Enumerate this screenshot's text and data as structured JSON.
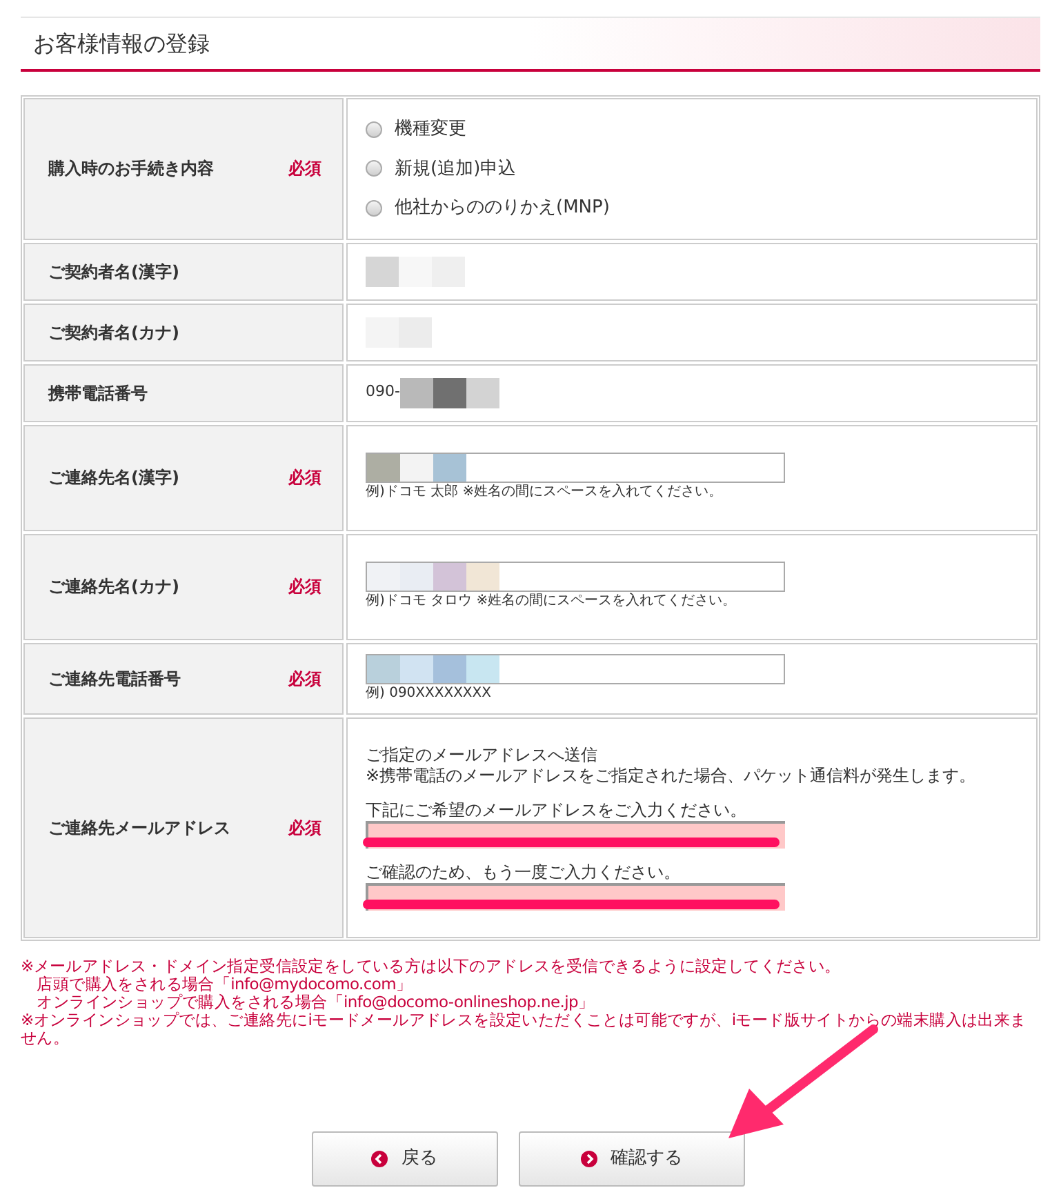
{
  "title": "お客様情報の登録",
  "rows": [
    {
      "label": "購入時のお手続き内容",
      "required": "必須",
      "kind": "radio",
      "options": [
        {
          "label": "機種変更",
          "selected": false
        },
        {
          "label": "新規(追加)申込",
          "selected": false
        },
        {
          "label": "他社からののりかえ(MNP)",
          "selected": false
        }
      ]
    },
    {
      "label": "ご契約者名(漢字)",
      "kind": "redacted"
    },
    {
      "label": "ご契約者名(カナ)",
      "kind": "redacted"
    },
    {
      "label": "携帯電話番号",
      "kind": "phone",
      "prefix": "090-"
    },
    {
      "label": "ご連絡先名(漢字)",
      "required": "必須",
      "kind": "input",
      "hint": "例)ドコモ 太郎 ※姓名の間にスペースを入れてください。"
    },
    {
      "label": "ご連絡先名(カナ)",
      "required": "必須",
      "kind": "input",
      "hint": "例)ドコモ タロウ ※姓名の間にスペースを入れてください。"
    },
    {
      "label": "ご連絡先電話番号",
      "required": "必須",
      "kind": "input",
      "hint": "例) 090XXXXXXXX"
    },
    {
      "label": "ご連絡先メールアドレス",
      "required": "必須",
      "kind": "email",
      "notes": [
        "ご指定のメールアドレスへ送信",
        "※携帯電話のメールアドレスをご指定された場合、パケット通信料が発生します。"
      ],
      "fields": [
        {
          "label": "下記にご希望のメールアドレスをご入力ください。",
          "highlighted": true
        },
        {
          "label": "ご確認のため、もう一度ご入力ください。",
          "highlighted": true
        }
      ]
    }
  ],
  "notice": [
    "※メールアドレス・ドメイン指定受信設定をしている方は以下のアドレスを受信できるように設定してください。",
    "　店頭で購入をされる場合「info@mydocomo.com」",
    "　オンラインショップで購入をされる場合「info@docomo-onlineshop.ne.jp」",
    "※オンラインショップでは、ご連絡先にiモードメールアドレスを設定いただくことは可能ですが、iモード版サイトからの端末購入は出来ません。"
  ],
  "buttons": [
    {
      "label": "戻る",
      "kind": "back"
    },
    {
      "label": "確認する",
      "kind": "next"
    }
  ],
  "annotation_arrow": true
}
